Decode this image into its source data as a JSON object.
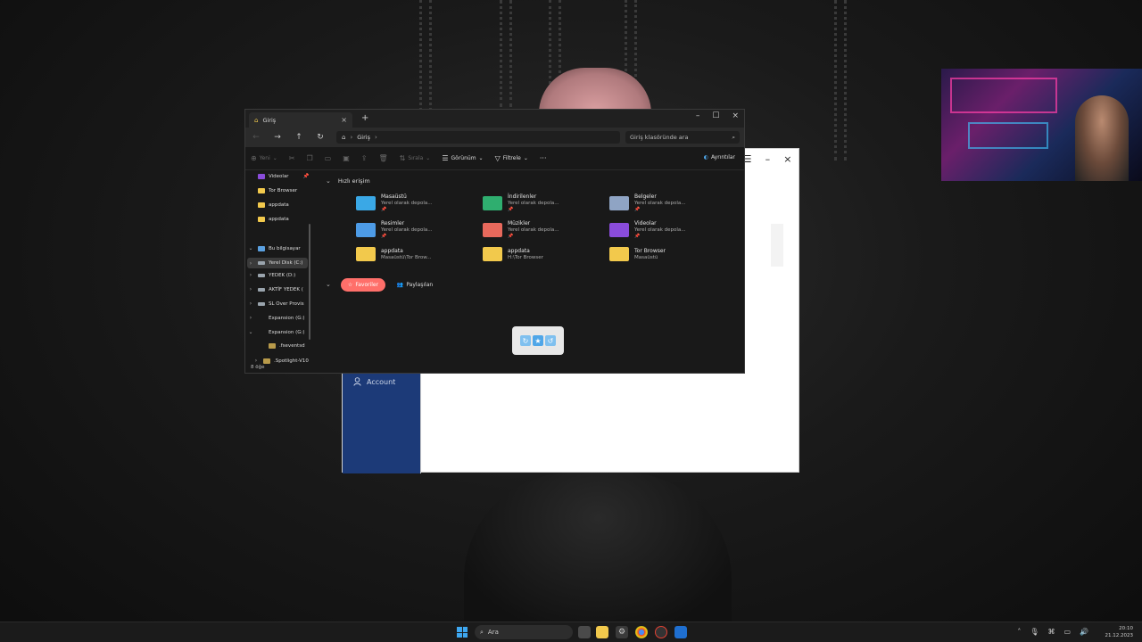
{
  "explorer": {
    "tab_title": "Giriş",
    "tab_close": "×",
    "new_tab": "+",
    "window_controls": {
      "minimize": "–",
      "maximize": "☐",
      "close": "×"
    },
    "breadcrumb": [
      "Giriş"
    ],
    "search_placeholder": "Giriş klasöründe ara",
    "toolbar": {
      "new_label": "Yeni",
      "sort_label": "Sırala",
      "view_label": "Görünüm",
      "filter_label": "Filtrele",
      "more_label": "···",
      "details_label": "Ayrıntılar"
    },
    "sidebar": {
      "pinned": [
        {
          "label": "Videolar"
        },
        {
          "label": "Tor Browser"
        },
        {
          "label": "appdata"
        },
        {
          "label": "appdata"
        }
      ],
      "this_pc": "Bu bilgisayar",
      "drives": [
        {
          "label": "Yerel Disk (C:)"
        },
        {
          "label": "YEDEK (D:)"
        },
        {
          "label": "AKTİF YEDEK ("
        },
        {
          "label": "SL Over Provis"
        },
        {
          "label": "Expansion (G:)"
        }
      ],
      "expanded_drive": "Expansion (G:)",
      "sub_items": [
        {
          "label": ".fseventsd"
        },
        {
          "label": ".Spotlight-V10"
        }
      ],
      "status": "8 öğe"
    },
    "quick_access": {
      "heading": "Hızlı erişim",
      "items": [
        {
          "name": "Masaüstü",
          "sub": "Yerel olarak depola...",
          "pin": "📌",
          "color": "#3aa8e6"
        },
        {
          "name": "İndirilenler",
          "sub": "Yerel olarak depola...",
          "pin": "📌",
          "color": "#2fae6f"
        },
        {
          "name": "Belgeler",
          "sub": "Yerel olarak depola...",
          "pin": "📌",
          "color": "#8fa4c4"
        },
        {
          "name": "Resimler",
          "sub": "Yerel olarak depola...",
          "pin": "📌",
          "color": "#4d9be6"
        },
        {
          "name": "Müzikler",
          "sub": "Yerel olarak depola...",
          "pin": "📌",
          "color": "#e8695c"
        },
        {
          "name": "Videolar",
          "sub": "Yerel olarak depola...",
          "pin": "📌",
          "color": "#8a4cdb"
        },
        {
          "name": "appdata",
          "sub": "Masaüstü\\Tor Brow...",
          "pin": "",
          "color": "#f2c94c"
        },
        {
          "name": "appdata",
          "sub": "H:\\Tor Browser",
          "pin": "",
          "color": "#f2c94c"
        },
        {
          "name": "Tor Browser",
          "sub": "Masaüstü",
          "pin": "",
          "color": "#f2c94c"
        }
      ]
    },
    "tabs_section": {
      "favorites": "Favoriler",
      "shared": "Paylaşılan"
    }
  },
  "background_window": {
    "account_label": "Account",
    "controls": {
      "menu": "☰",
      "minimize": "–",
      "close": "×"
    },
    "sidebar_color": "#1c3a78"
  },
  "taskbar": {
    "search_label": "Ara",
    "time": "20:10",
    "date": "21.12.2023"
  }
}
